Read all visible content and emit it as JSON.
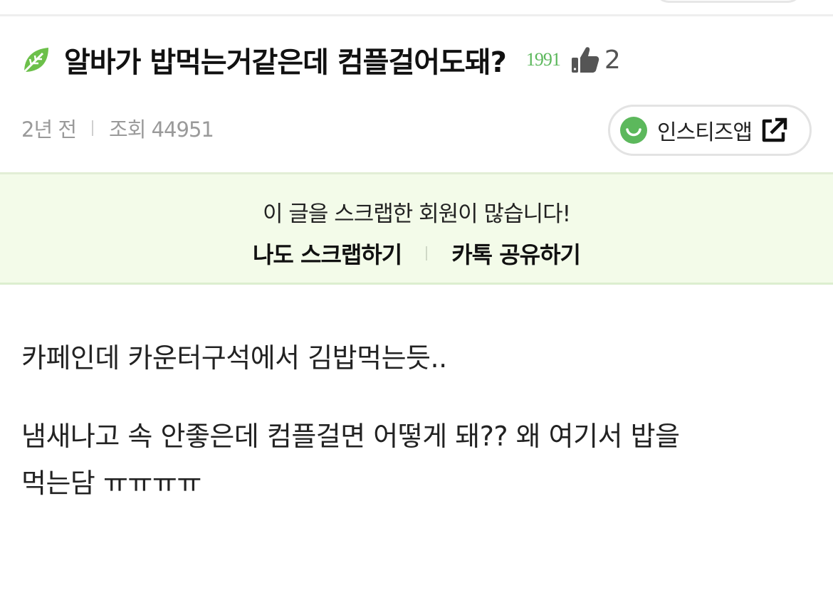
{
  "post": {
    "title": "알바가 밥먹는거같은데 컴플걸어도돼?",
    "scrap_count": "1991",
    "like_count": "2",
    "time_ago": "2년 전",
    "views_label": "조회 44951",
    "app_button_label": "인스티즈앱"
  },
  "scrap_banner": {
    "message": "이 글을 스크랩한 회원이 많습니다!",
    "scrap_button": "나도 스크랩하기",
    "share_button": "카톡 공유하기"
  },
  "body": {
    "paragraphs": [
      [
        "카페인데 카운터구석에서 김밥먹는듯.."
      ],
      [
        "냄새나고 속 안좋은데 컴플걸면 어떻게 돼?? 왜 여기서 밥을",
        "먹는담 ㅠㅠㅠㅠ"
      ]
    ]
  },
  "icons": {
    "leaf": "leaf-icon",
    "like": "thumbs-up-icon",
    "app": "smile-icon",
    "external": "external-link-icon"
  },
  "colors": {
    "accent_green": "#5cb85c",
    "banner_bg": "#f3fbe9"
  }
}
